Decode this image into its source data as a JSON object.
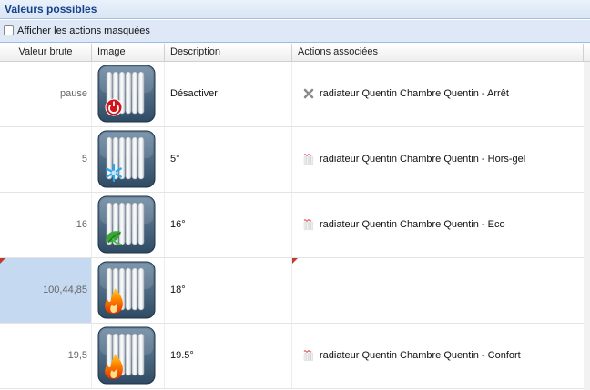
{
  "panel": {
    "title": "Valeurs possibles"
  },
  "toolbar": {
    "show_hidden_label": "Afficher les actions masquées",
    "show_hidden_checked": false
  },
  "columns": [
    "Valeur brute",
    "Image",
    "Description",
    "Actions associées"
  ],
  "rows": [
    {
      "value": "pause",
      "description": "Désactiver",
      "image_icon": "radiator-power-icon",
      "action": "radiateur Quentin Chambre Quentin - Arrêt",
      "action_icon": "close-icon",
      "selected": false,
      "modified": false
    },
    {
      "value": "5",
      "description": "5°",
      "image_icon": "radiator-snowflake-icon",
      "action": "radiateur Quentin Chambre Quentin - Hors-gel",
      "action_icon": "radiator-icon",
      "selected": false,
      "modified": false
    },
    {
      "value": "16",
      "description": "16°",
      "image_icon": "radiator-eco-icon",
      "action": "radiateur Quentin Chambre Quentin - Eco",
      "action_icon": "radiator-icon",
      "selected": false,
      "modified": false
    },
    {
      "value": "100,44,85",
      "description": "18°",
      "image_icon": "radiator-flame-icon",
      "action": "",
      "action_icon": "",
      "selected": true,
      "modified": true
    },
    {
      "value": "19,5",
      "description": "19.5°",
      "image_icon": "radiator-flame-icon",
      "action": "radiateur Quentin Chambre Quentin - Confort",
      "action_icon": "radiator-icon",
      "selected": false,
      "modified": false
    }
  ],
  "colors": {
    "header_text": "#15428b",
    "selected_cell": "#c5d9f1",
    "modified_marker": "#c0392b"
  }
}
